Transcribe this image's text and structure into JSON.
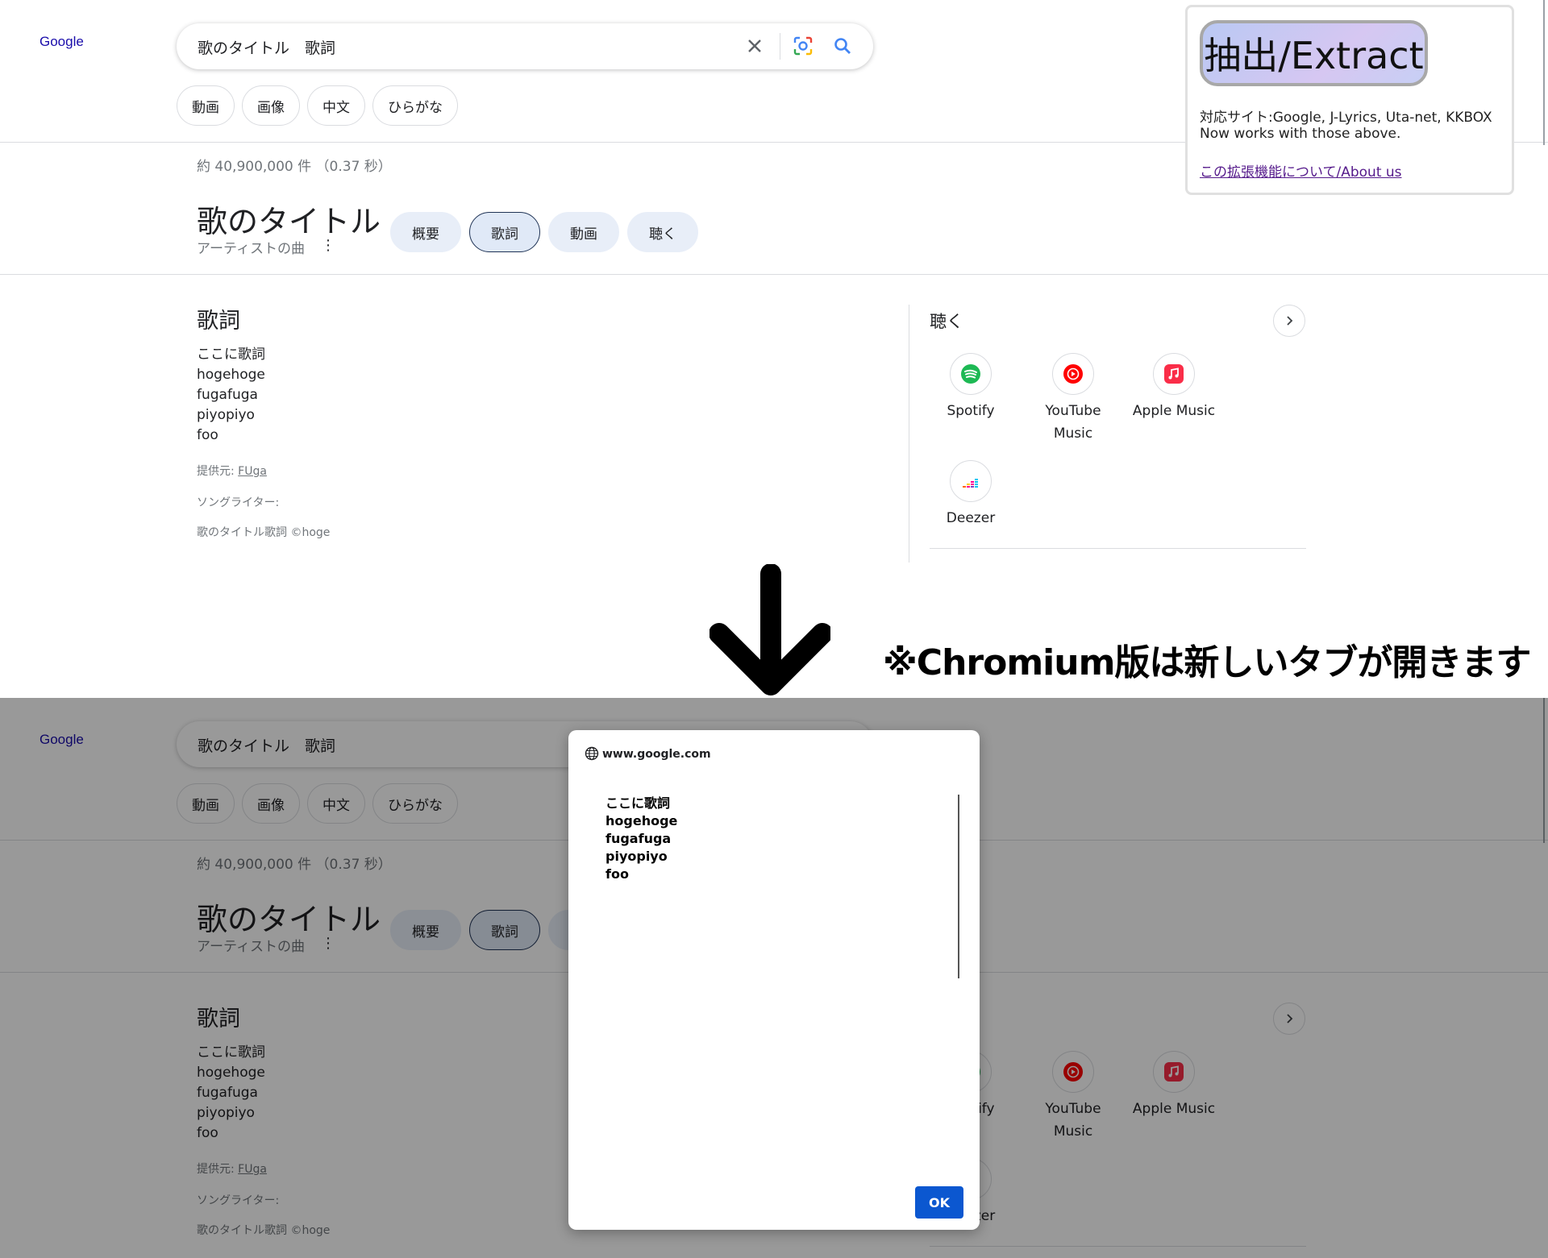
{
  "google": {
    "logo": "Google",
    "query": "歌のタイトル　歌詞",
    "chips": [
      "動画",
      "画像",
      "中文",
      "ひらがな"
    ],
    "stats": "約 40,900,000 件 （0.37 秒）",
    "kp_title": "歌のタイトル",
    "kp_subtitle": "アーティストの曲",
    "kp_tabs": [
      "概要",
      "歌詞",
      "動画",
      "聴く"
    ],
    "active_tab": "歌詞",
    "lyrics_heading": "歌詞",
    "lyrics_lines": [
      "ここに歌詞",
      "hogehoge",
      "fugafuga",
      "piyopiyo",
      "foo"
    ],
    "source_label": "提供元:",
    "source_link": "FUga",
    "songwriter_label": "ソングライター:",
    "copyright": "歌のタイトル歌詞 ©hoge",
    "listen_title": "聴く",
    "services": [
      {
        "line1": "Spotify",
        "line2": "",
        "icon": "spotify-icon",
        "color": "#1DB954"
      },
      {
        "line1": "YouTube",
        "line2": "Music",
        "icon": "youtube-music-icon",
        "color": "#FF0000"
      },
      {
        "line1": "Apple Music",
        "line2": "",
        "icon": "apple-music-icon",
        "color": "#FA2D48"
      },
      {
        "line1": "Deezer",
        "line2": "",
        "icon": "deezer-icon",
        "color": "#A238FF"
      }
    ]
  },
  "popup": {
    "button": "抽出/Extract",
    "supported_line": "対応サイト:Google, J-Lyrics, Uta-net, KKBOX",
    "note_line": "Now works with those above.",
    "about_link": "この拡張機能について/About us"
  },
  "annotation": "※Chromium版は新しいタブが開きます",
  "dialog": {
    "origin": "www.google.com",
    "lines": [
      "ここに歌詞",
      "hogehoge",
      "fugafuga",
      "piyopiyo",
      "foo"
    ],
    "ok": "OK"
  },
  "colors": {
    "link": "#1a0dab",
    "visited": "#551a8b",
    "tab_bg": "#e8eef8",
    "ok_button": "#0b57d0"
  }
}
